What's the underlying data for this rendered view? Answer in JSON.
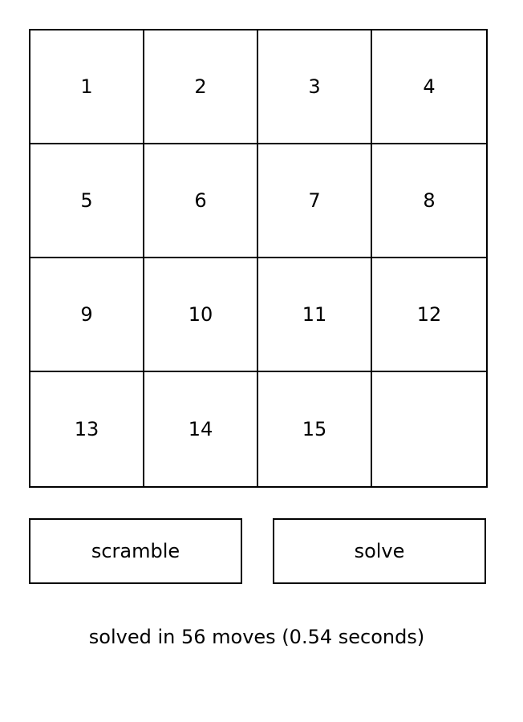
{
  "board": {
    "tiles": [
      "1",
      "2",
      "3",
      "4",
      "5",
      "6",
      "7",
      "8",
      "9",
      "10",
      "11",
      "12",
      "13",
      "14",
      "15",
      ""
    ]
  },
  "controls": {
    "scramble_label": "scramble",
    "solve_label": "solve"
  },
  "status": {
    "text": "solved in 56 moves (0.54 seconds)"
  }
}
